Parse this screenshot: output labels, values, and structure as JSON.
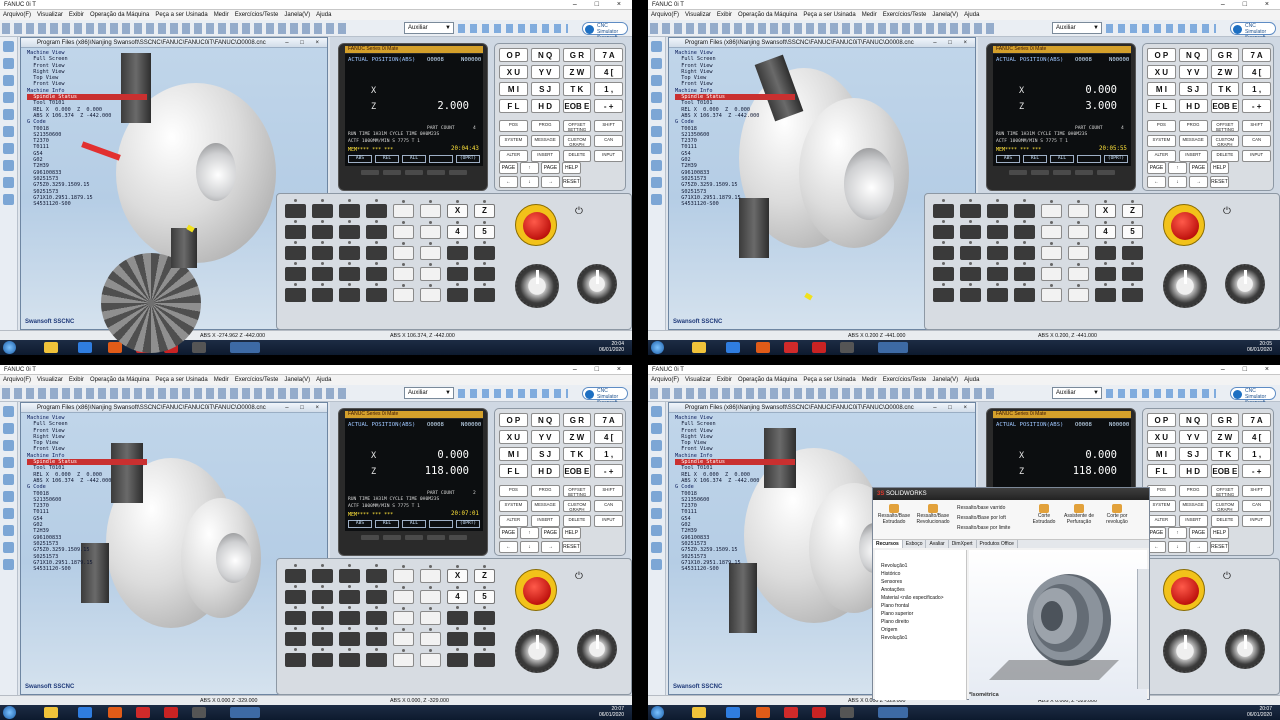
{
  "app": {
    "title": "FANUC 0i T",
    "window_controls": "– □ ×",
    "menu": [
      "Arquivo(F)",
      "Visualizar",
      "Exibir",
      "Operação da Máquina",
      "Peça a ser Usinada",
      "Medir",
      "Exercícios/Teste",
      "Janela(V)",
      "Ajuda"
    ],
    "toolbar_dropdown": "Auxiliar",
    "logo_text": "CNC Simulator Swansoft"
  },
  "view": {
    "title": "Program Files (x86)\\Nanjing Swansoft\\SSCNC\\FANUC\\FANUC0iT\\FANUC\\O0008.cnc",
    "controls": "– □ ×",
    "axes_label": "Swansoft SSCNC"
  },
  "tree": [
    "Machine View",
    "  Full Screen",
    "  Front View",
    "  Right View",
    "  Top View",
    "  Front View",
    "Machine Info",
    "  Spindle Status",
    "  Tool T0101",
    "  REL X  0.000  Z  0.000",
    "  ABS X 106.374  Z -442.000",
    "G Code",
    "  T0018",
    "  S21350600",
    "  T2370",
    "  T0111",
    "  G54",
    "  G02",
    "  T2H39",
    "  G96100833",
    "  S0251573",
    "  G75Z0.3259.1509.15",
    "  S0251573",
    "  G71X10.2951.1879.15",
    "  S4531120-S00"
  ],
  "quadrants": [
    {
      "x": "",
      "z": "2.000",
      "clock": "20:04:43",
      "part_count": "4",
      "task_time": "20:04",
      "status_abs": "ABS X -274.962  Z -442.000",
      "status_rel": "ABS X 106.374, Z -442.000"
    },
    {
      "x": "0.000",
      "z": "3.000",
      "clock": "20:05:55",
      "part_count": "4",
      "task_time": "20:05",
      "status_abs": "ABS X 0.200  Z -441.000",
      "status_rel": "ABS X 0.200, Z -441.000"
    },
    {
      "x": "0.000",
      "z": "118.000",
      "clock": "20:07:01",
      "part_count": "2",
      "task_time": "20:07",
      "status_abs": "ABS X 0.000  Z -329.000",
      "status_rel": "ABS X 0.000, Z -329.000"
    },
    {
      "x": "0.000",
      "z": "118.000",
      "clock": "20:07:01",
      "part_count": "2",
      "task_time": "20:07",
      "status_abs": "ABS X 0.000  Z -329.000",
      "status_rel": "ABS X 0.000, Z -329.000"
    }
  ],
  "screen": {
    "header": "FANUC Series 0i Mate",
    "title": "ACTUAL POSITION(ABS)",
    "o_number": "O0008",
    "n_number": "N00000",
    "x_label": "X",
    "z_label": "Z",
    "part_count_label": "PART COUNT",
    "run_time": "RUN TIME     1H31M     CYCLE TIME  0H0M23S",
    "actf": "ACTF     1000MM/MIN  S    7775   T     1",
    "mem": "MEM**** ***  ***",
    "softkeys": [
      "ABS",
      "REL",
      "ALL",
      "",
      "(OPRT)"
    ]
  },
  "keypad": {
    "keys": [
      "O P",
      "N Q",
      "G R",
      "7 A",
      "X U",
      "Y V",
      "Z W",
      "4 [",
      "M I",
      "S J",
      "T K",
      "1 ,",
      "F L",
      "H D",
      "EOB E",
      "- +"
    ],
    "func_keys": [
      "POS",
      "PROG",
      "OFFSET SETTING",
      "SHIFT",
      "SYSTEM",
      "MESSAGE",
      "CUSTOM GRAPH",
      "CAN",
      "ALTER",
      "INSERT",
      "DELETE",
      "INPUT"
    ],
    "arrows": [
      "PAGE",
      "↑",
      "PAGE",
      "HELP",
      "←",
      "↓",
      "→",
      "RESET"
    ]
  },
  "operator_panel": {
    "keys": [
      "",
      "",
      "",
      "",
      "",
      "",
      "X",
      "Z",
      "",
      "",
      "",
      "",
      "",
      "",
      "4",
      "5",
      "",
      "",
      "",
      "",
      "",
      "",
      "",
      "",
      "",
      "",
      "",
      "",
      "",
      "",
      "",
      "",
      "",
      "",
      "",
      "",
      "",
      "",
      "",
      ""
    ]
  },
  "taskbar": {
    "date": "06/01/2020"
  },
  "solidworks": {
    "title": "SOLIDWORKS",
    "ribbon": [
      "Ressalto/Base Extrudado",
      "Ressalto/Base Revolucionado",
      "Ressalto/base varrido",
      "Ressalto/Base por loft",
      "Ressalto/base por limite",
      "Corte Extrudado",
      "Assistente de Perfuração",
      "Corte por revolução"
    ],
    "tabs": [
      "Recursos",
      "Esboço",
      "Avaliar",
      "DimXpert",
      "Produtos Office"
    ],
    "tree": [
      "Revolução1",
      "Histórico",
      "Sensores",
      "Anotações",
      "Material <não especificado>",
      "Plano frontal",
      "Plano superior",
      "Plano direito",
      "Origem",
      "Revolução1"
    ],
    "view_label": "*Isométrica"
  }
}
